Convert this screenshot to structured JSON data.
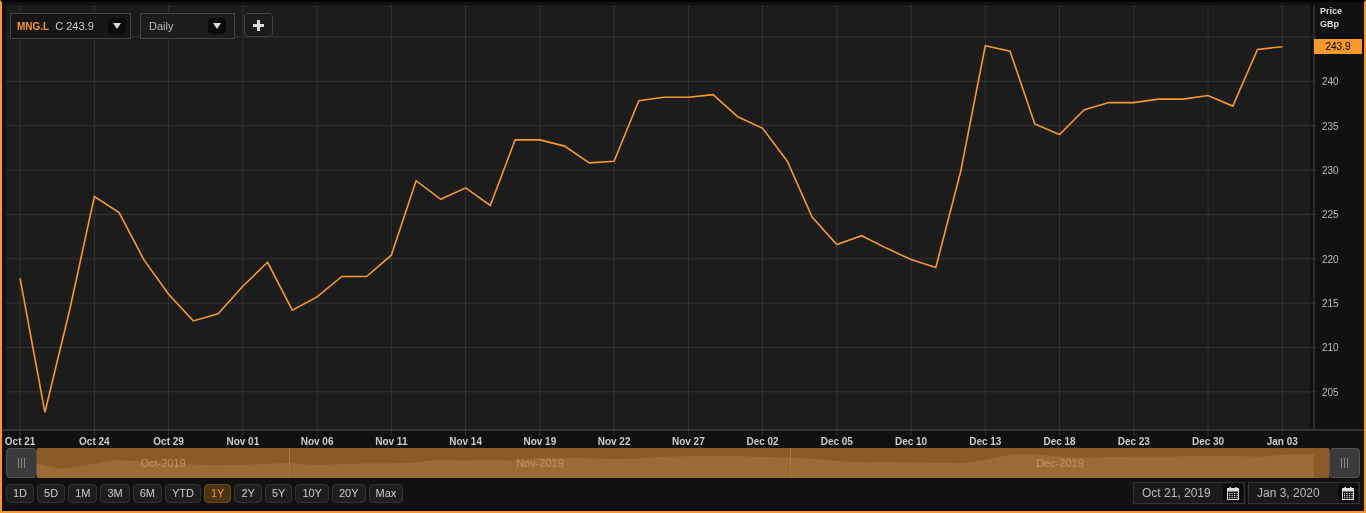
{
  "toolbar": {
    "last_quote": "C 243.9",
    "interval": "Daily"
  },
  "price_axis": {
    "title": "Price",
    "unit": "GBp",
    "current_price": "243.9"
  },
  "chart_data": {
    "type": "line",
    "categories": [
      "Oct 21",
      null,
      null,
      "Oct 24",
      null,
      null,
      "Oct 29",
      null,
      null,
      "Nov 01",
      null,
      null,
      "Nov 06",
      null,
      null,
      "Nov 11",
      null,
      null,
      "Nov 14",
      null,
      null,
      "Nov 19",
      null,
      null,
      "Nov 22",
      null,
      null,
      "Nov 27",
      null,
      null,
      "Dec 02",
      null,
      null,
      "Dec 05",
      null,
      null,
      "Dec 10",
      null,
      null,
      "Dec 13",
      null,
      null,
      "Dec 18",
      null,
      null,
      "Dec 23",
      null,
      null,
      "Dec 30",
      null,
      null,
      "Jan 03"
    ],
    "series": [
      {
        "name": "MNG.L",
        "color": "#f7982f",
        "values": [
          217.8,
          202.7,
          214.2,
          227,
          225.2,
          219.9,
          216,
          213,
          213.8,
          216.9,
          219.6,
          214.2,
          215.7,
          218,
          218,
          220.4,
          228.8,
          226.7,
          228,
          226,
          233.4,
          233.4,
          232.7,
          230.8,
          231,
          237.8,
          238.2,
          238.2,
          238.5,
          236,
          234.7,
          231,
          224.7,
          221.6,
          222.6,
          221.2,
          219.9,
          219,
          229.8,
          244,
          243.4,
          235.2,
          234,
          236.8,
          237.6,
          237.6,
          238,
          238,
          238.4,
          237.2,
          243.6,
          243.9
        ]
      }
    ],
    "grid": true,
    "ylim": [
      200.7,
      248.6
    ],
    "yticks": [
      205,
      210,
      215,
      220,
      225,
      230,
      235,
      240
    ]
  },
  "navigator": {
    "months": [
      "Oct-2019",
      "Nov-2019",
      "Dec-2019"
    ]
  },
  "range_buttons": [
    {
      "label": "1D",
      "selected": false
    },
    {
      "label": "5D",
      "selected": false
    },
    {
      "label": "1M",
      "selected": false
    },
    {
      "label": "3M",
      "selected": false
    },
    {
      "label": "6M",
      "selected": false
    },
    {
      "label": "YTD",
      "selected": false
    },
    {
      "label": "1Y",
      "selected": true
    },
    {
      "label": "2Y",
      "selected": false
    },
    {
      "label": "5Y",
      "selected": false
    },
    {
      "label": "10Y",
      "selected": false
    },
    {
      "label": "20Y",
      "selected": false
    },
    {
      "label": "Max",
      "selected": false
    }
  ],
  "date_range": {
    "start": "Oct 21, 2019",
    "end": "Jan 3, 2020"
  }
}
